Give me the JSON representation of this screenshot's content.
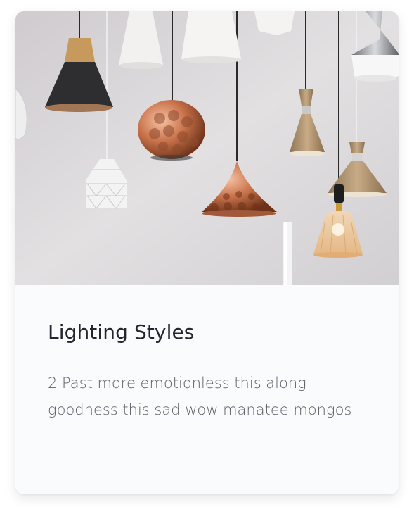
{
  "card": {
    "title": "Lighting Styles",
    "description": "2 Past more emotionless this along goodness this sad wow manatee mongos",
    "image_subject": "pendant-lamps-photo"
  },
  "colors": {
    "card_background": "#fafbfd",
    "title_text": "#22262e",
    "body_text": "#5e626a",
    "wall": "#d9d6d8"
  }
}
